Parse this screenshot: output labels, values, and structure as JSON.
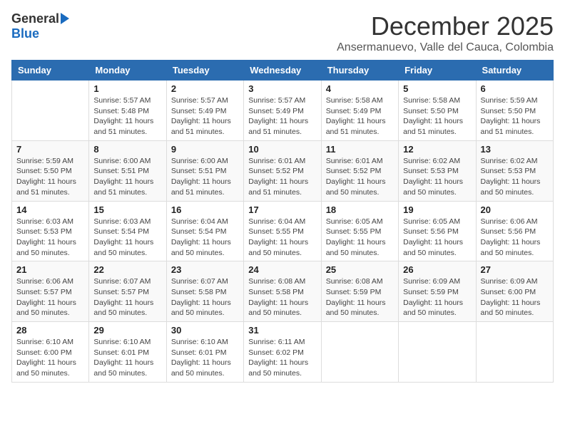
{
  "logo": {
    "general": "General",
    "blue": "Blue"
  },
  "header": {
    "month": "December 2025",
    "location": "Ansermanuevo, Valle del Cauca, Colombia"
  },
  "days_of_week": [
    "Sunday",
    "Monday",
    "Tuesday",
    "Wednesday",
    "Thursday",
    "Friday",
    "Saturday"
  ],
  "weeks": [
    [
      {
        "day": "",
        "info": ""
      },
      {
        "day": "1",
        "info": "Sunrise: 5:57 AM\nSunset: 5:48 PM\nDaylight: 11 hours\nand 51 minutes."
      },
      {
        "day": "2",
        "info": "Sunrise: 5:57 AM\nSunset: 5:49 PM\nDaylight: 11 hours\nand 51 minutes."
      },
      {
        "day": "3",
        "info": "Sunrise: 5:57 AM\nSunset: 5:49 PM\nDaylight: 11 hours\nand 51 minutes."
      },
      {
        "day": "4",
        "info": "Sunrise: 5:58 AM\nSunset: 5:49 PM\nDaylight: 11 hours\nand 51 minutes."
      },
      {
        "day": "5",
        "info": "Sunrise: 5:58 AM\nSunset: 5:50 PM\nDaylight: 11 hours\nand 51 minutes."
      },
      {
        "day": "6",
        "info": "Sunrise: 5:59 AM\nSunset: 5:50 PM\nDaylight: 11 hours\nand 51 minutes."
      }
    ],
    [
      {
        "day": "7",
        "info": "Sunrise: 5:59 AM\nSunset: 5:50 PM\nDaylight: 11 hours\nand 51 minutes."
      },
      {
        "day": "8",
        "info": "Sunrise: 6:00 AM\nSunset: 5:51 PM\nDaylight: 11 hours\nand 51 minutes."
      },
      {
        "day": "9",
        "info": "Sunrise: 6:00 AM\nSunset: 5:51 PM\nDaylight: 11 hours\nand 51 minutes."
      },
      {
        "day": "10",
        "info": "Sunrise: 6:01 AM\nSunset: 5:52 PM\nDaylight: 11 hours\nand 51 minutes."
      },
      {
        "day": "11",
        "info": "Sunrise: 6:01 AM\nSunset: 5:52 PM\nDaylight: 11 hours\nand 50 minutes."
      },
      {
        "day": "12",
        "info": "Sunrise: 6:02 AM\nSunset: 5:53 PM\nDaylight: 11 hours\nand 50 minutes."
      },
      {
        "day": "13",
        "info": "Sunrise: 6:02 AM\nSunset: 5:53 PM\nDaylight: 11 hours\nand 50 minutes."
      }
    ],
    [
      {
        "day": "14",
        "info": "Sunrise: 6:03 AM\nSunset: 5:53 PM\nDaylight: 11 hours\nand 50 minutes."
      },
      {
        "day": "15",
        "info": "Sunrise: 6:03 AM\nSunset: 5:54 PM\nDaylight: 11 hours\nand 50 minutes."
      },
      {
        "day": "16",
        "info": "Sunrise: 6:04 AM\nSunset: 5:54 PM\nDaylight: 11 hours\nand 50 minutes."
      },
      {
        "day": "17",
        "info": "Sunrise: 6:04 AM\nSunset: 5:55 PM\nDaylight: 11 hours\nand 50 minutes."
      },
      {
        "day": "18",
        "info": "Sunrise: 6:05 AM\nSunset: 5:55 PM\nDaylight: 11 hours\nand 50 minutes."
      },
      {
        "day": "19",
        "info": "Sunrise: 6:05 AM\nSunset: 5:56 PM\nDaylight: 11 hours\nand 50 minutes."
      },
      {
        "day": "20",
        "info": "Sunrise: 6:06 AM\nSunset: 5:56 PM\nDaylight: 11 hours\nand 50 minutes."
      }
    ],
    [
      {
        "day": "21",
        "info": "Sunrise: 6:06 AM\nSunset: 5:57 PM\nDaylight: 11 hours\nand 50 minutes."
      },
      {
        "day": "22",
        "info": "Sunrise: 6:07 AM\nSunset: 5:57 PM\nDaylight: 11 hours\nand 50 minutes."
      },
      {
        "day": "23",
        "info": "Sunrise: 6:07 AM\nSunset: 5:58 PM\nDaylight: 11 hours\nand 50 minutes."
      },
      {
        "day": "24",
        "info": "Sunrise: 6:08 AM\nSunset: 5:58 PM\nDaylight: 11 hours\nand 50 minutes."
      },
      {
        "day": "25",
        "info": "Sunrise: 6:08 AM\nSunset: 5:59 PM\nDaylight: 11 hours\nand 50 minutes."
      },
      {
        "day": "26",
        "info": "Sunrise: 6:09 AM\nSunset: 5:59 PM\nDaylight: 11 hours\nand 50 minutes."
      },
      {
        "day": "27",
        "info": "Sunrise: 6:09 AM\nSunset: 6:00 PM\nDaylight: 11 hours\nand 50 minutes."
      }
    ],
    [
      {
        "day": "28",
        "info": "Sunrise: 6:10 AM\nSunset: 6:00 PM\nDaylight: 11 hours\nand 50 minutes."
      },
      {
        "day": "29",
        "info": "Sunrise: 6:10 AM\nSunset: 6:01 PM\nDaylight: 11 hours\nand 50 minutes."
      },
      {
        "day": "30",
        "info": "Sunrise: 6:10 AM\nSunset: 6:01 PM\nDaylight: 11 hours\nand 50 minutes."
      },
      {
        "day": "31",
        "info": "Sunrise: 6:11 AM\nSunset: 6:02 PM\nDaylight: 11 hours\nand 50 minutes."
      },
      {
        "day": "",
        "info": ""
      },
      {
        "day": "",
        "info": ""
      },
      {
        "day": "",
        "info": ""
      }
    ]
  ]
}
